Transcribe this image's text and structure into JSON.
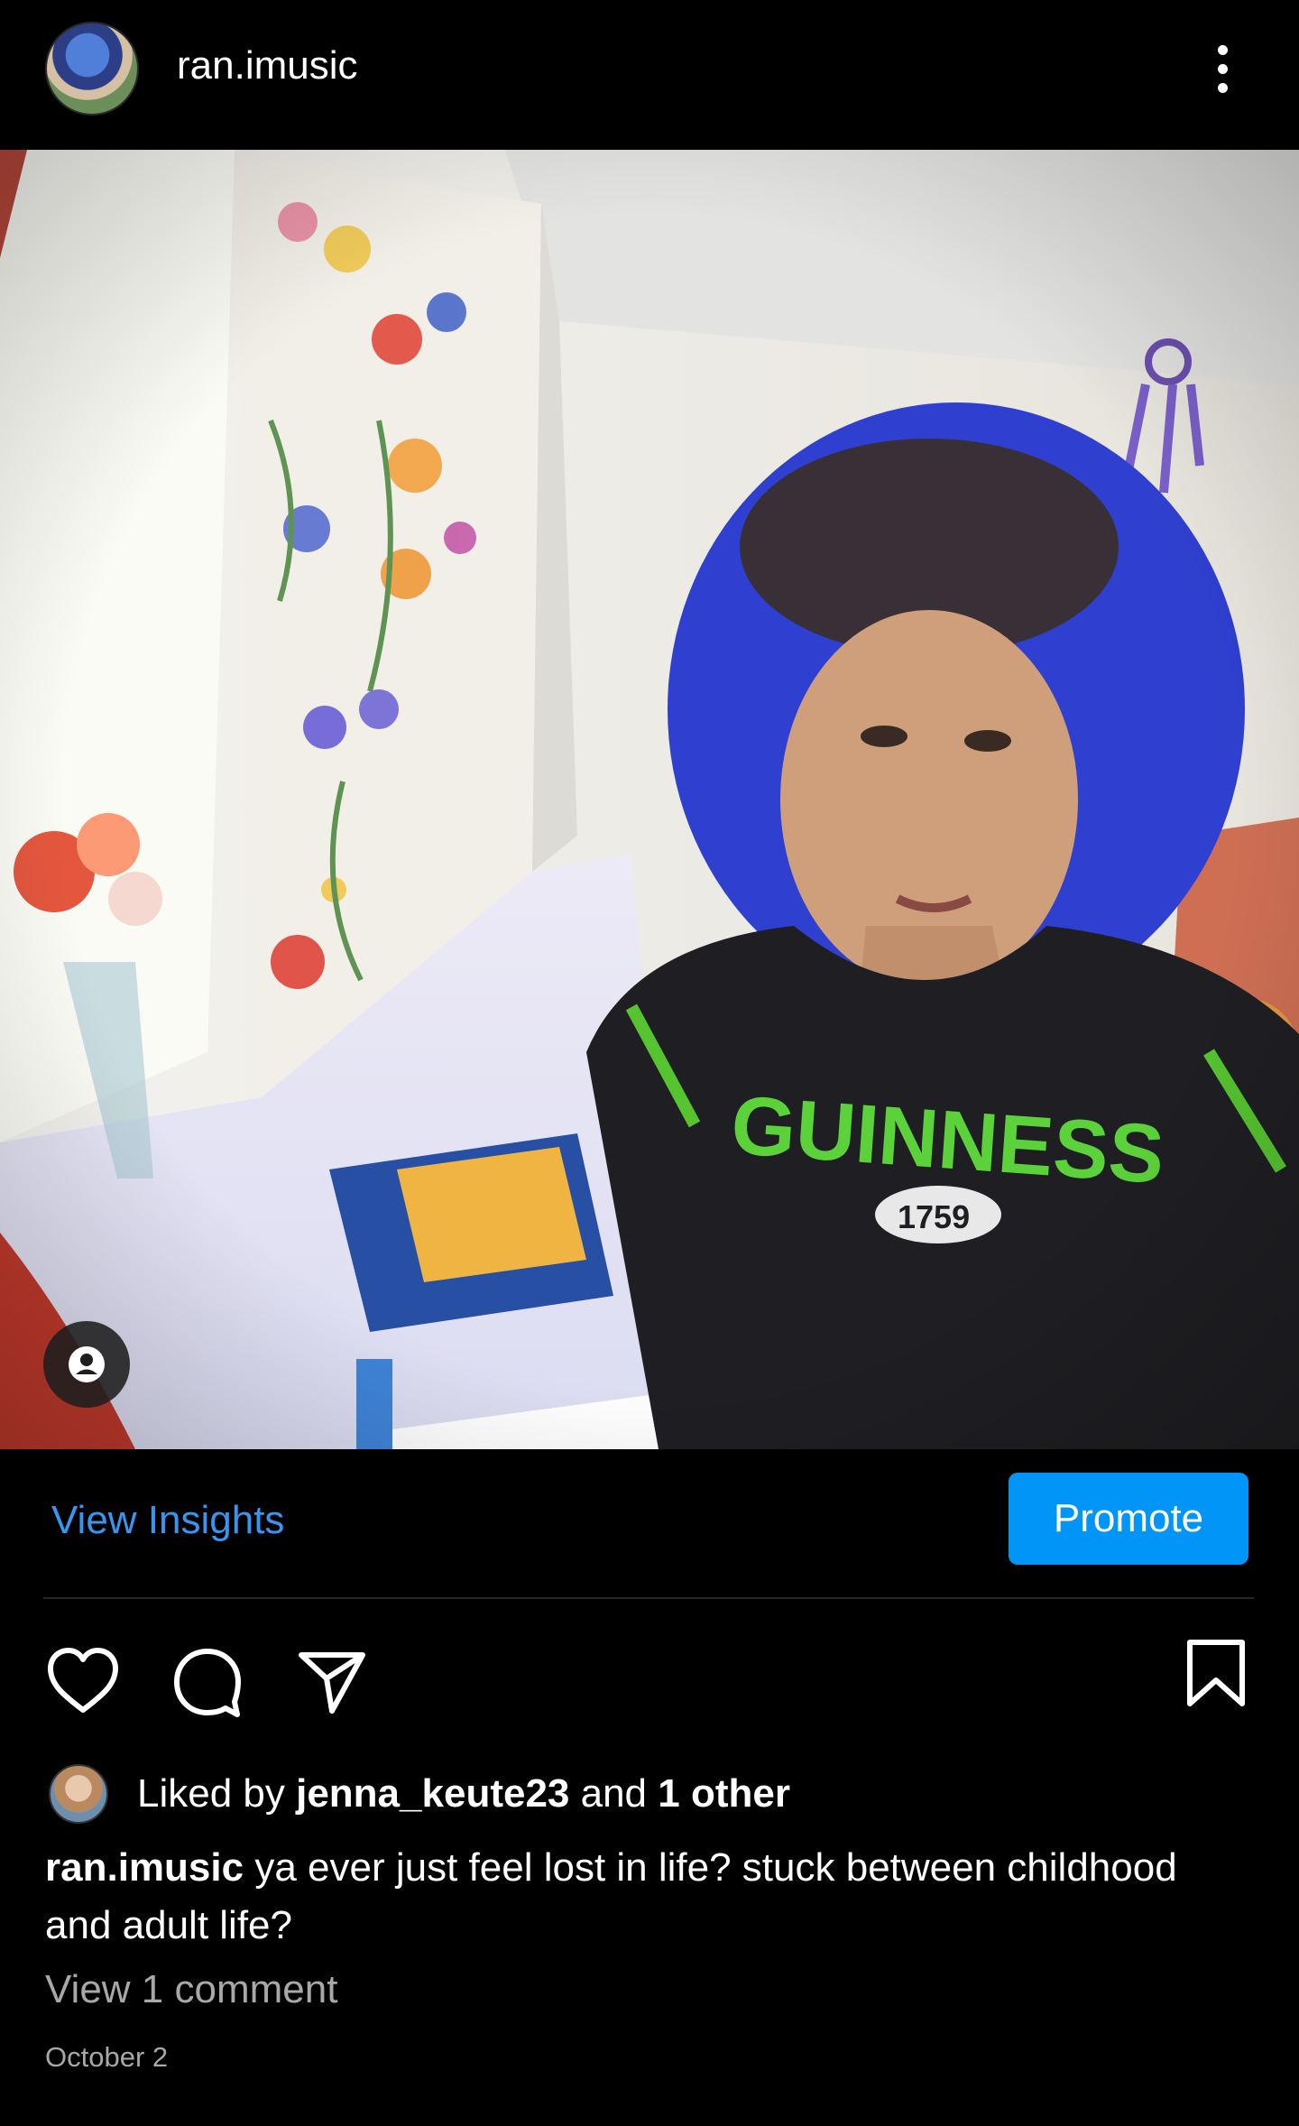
{
  "header": {
    "username": "ran.imusic",
    "avatar_icon": "profile-avatar",
    "more_icon": "more-vertical-icon"
  },
  "photo": {
    "tag_icon": "user-tag-icon"
  },
  "insights": {
    "view_insights_label": "View Insights",
    "promote_label": "Promote"
  },
  "actions": {
    "like_icon": "heart-icon",
    "comment_icon": "comment-icon",
    "share_icon": "share-icon",
    "save_icon": "bookmark-icon"
  },
  "likes": {
    "prefix": "Liked by ",
    "user": "jenna_keute23",
    "middle": " and ",
    "others": "1 other"
  },
  "caption": {
    "username": "ran.imusic",
    "text": " ya ever just feel lost in life? stuck between childhood and  adult life?"
  },
  "view_comments": "View 1 comment",
  "date": "October 2",
  "colors": {
    "background": "#000000",
    "link_blue": "#3797f0",
    "promote_blue": "#0095f6",
    "secondary_text": "#a8a8a8"
  }
}
